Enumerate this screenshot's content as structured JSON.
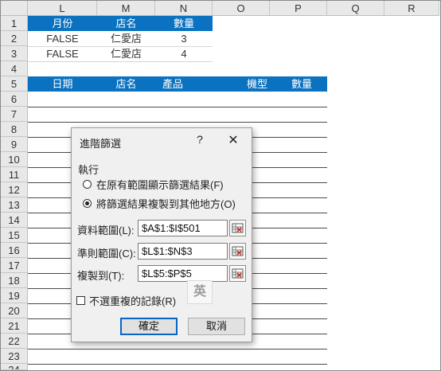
{
  "columns": [
    "L",
    "M",
    "N",
    "O",
    "P",
    "Q",
    "R"
  ],
  "rows": [
    "1",
    "2",
    "3",
    "4",
    "5",
    "6",
    "7",
    "8",
    "9",
    "10",
    "11",
    "12",
    "13",
    "14",
    "15",
    "16",
    "17",
    "18",
    "19",
    "20",
    "21",
    "22",
    "23",
    "24"
  ],
  "criteria": {
    "headers": [
      "月份",
      "店名",
      "數量"
    ],
    "rows": [
      [
        "FALSE",
        "仁愛店",
        "3"
      ],
      [
        "FALSE",
        "仁愛店",
        "4"
      ]
    ]
  },
  "output_headers": {
    "date": "日期",
    "store": "店名",
    "product": "產品",
    "model": "機型",
    "qty": "數量"
  },
  "dialog": {
    "title": "進階篩選",
    "help": "?",
    "close": "✕",
    "section_label": "執行",
    "radio_filter_in_place": "在原有範圍顯示篩選結果(F)",
    "radio_copy_to": "將篩選結果複製到其他地方(O)",
    "list_range_label": "資料範圍(L):",
    "list_range_value": "$A$1:$I$501",
    "criteria_range_label": "準則範圍(C):",
    "criteria_range_value": "$L$1:$N$3",
    "copy_to_label": "複製到(T):",
    "copy_to_value": "$L$5:$P$5",
    "ime_indicator": "英",
    "unique_label": "不選重複的記錄(R)",
    "ok": "確定",
    "cancel": "取消",
    "selected_option": "copy_to",
    "unique_checked": false
  },
  "colors": {
    "header_fill": "#0a72c0",
    "header_text": "#ffffff",
    "default_button_border": "#0a64c8"
  }
}
